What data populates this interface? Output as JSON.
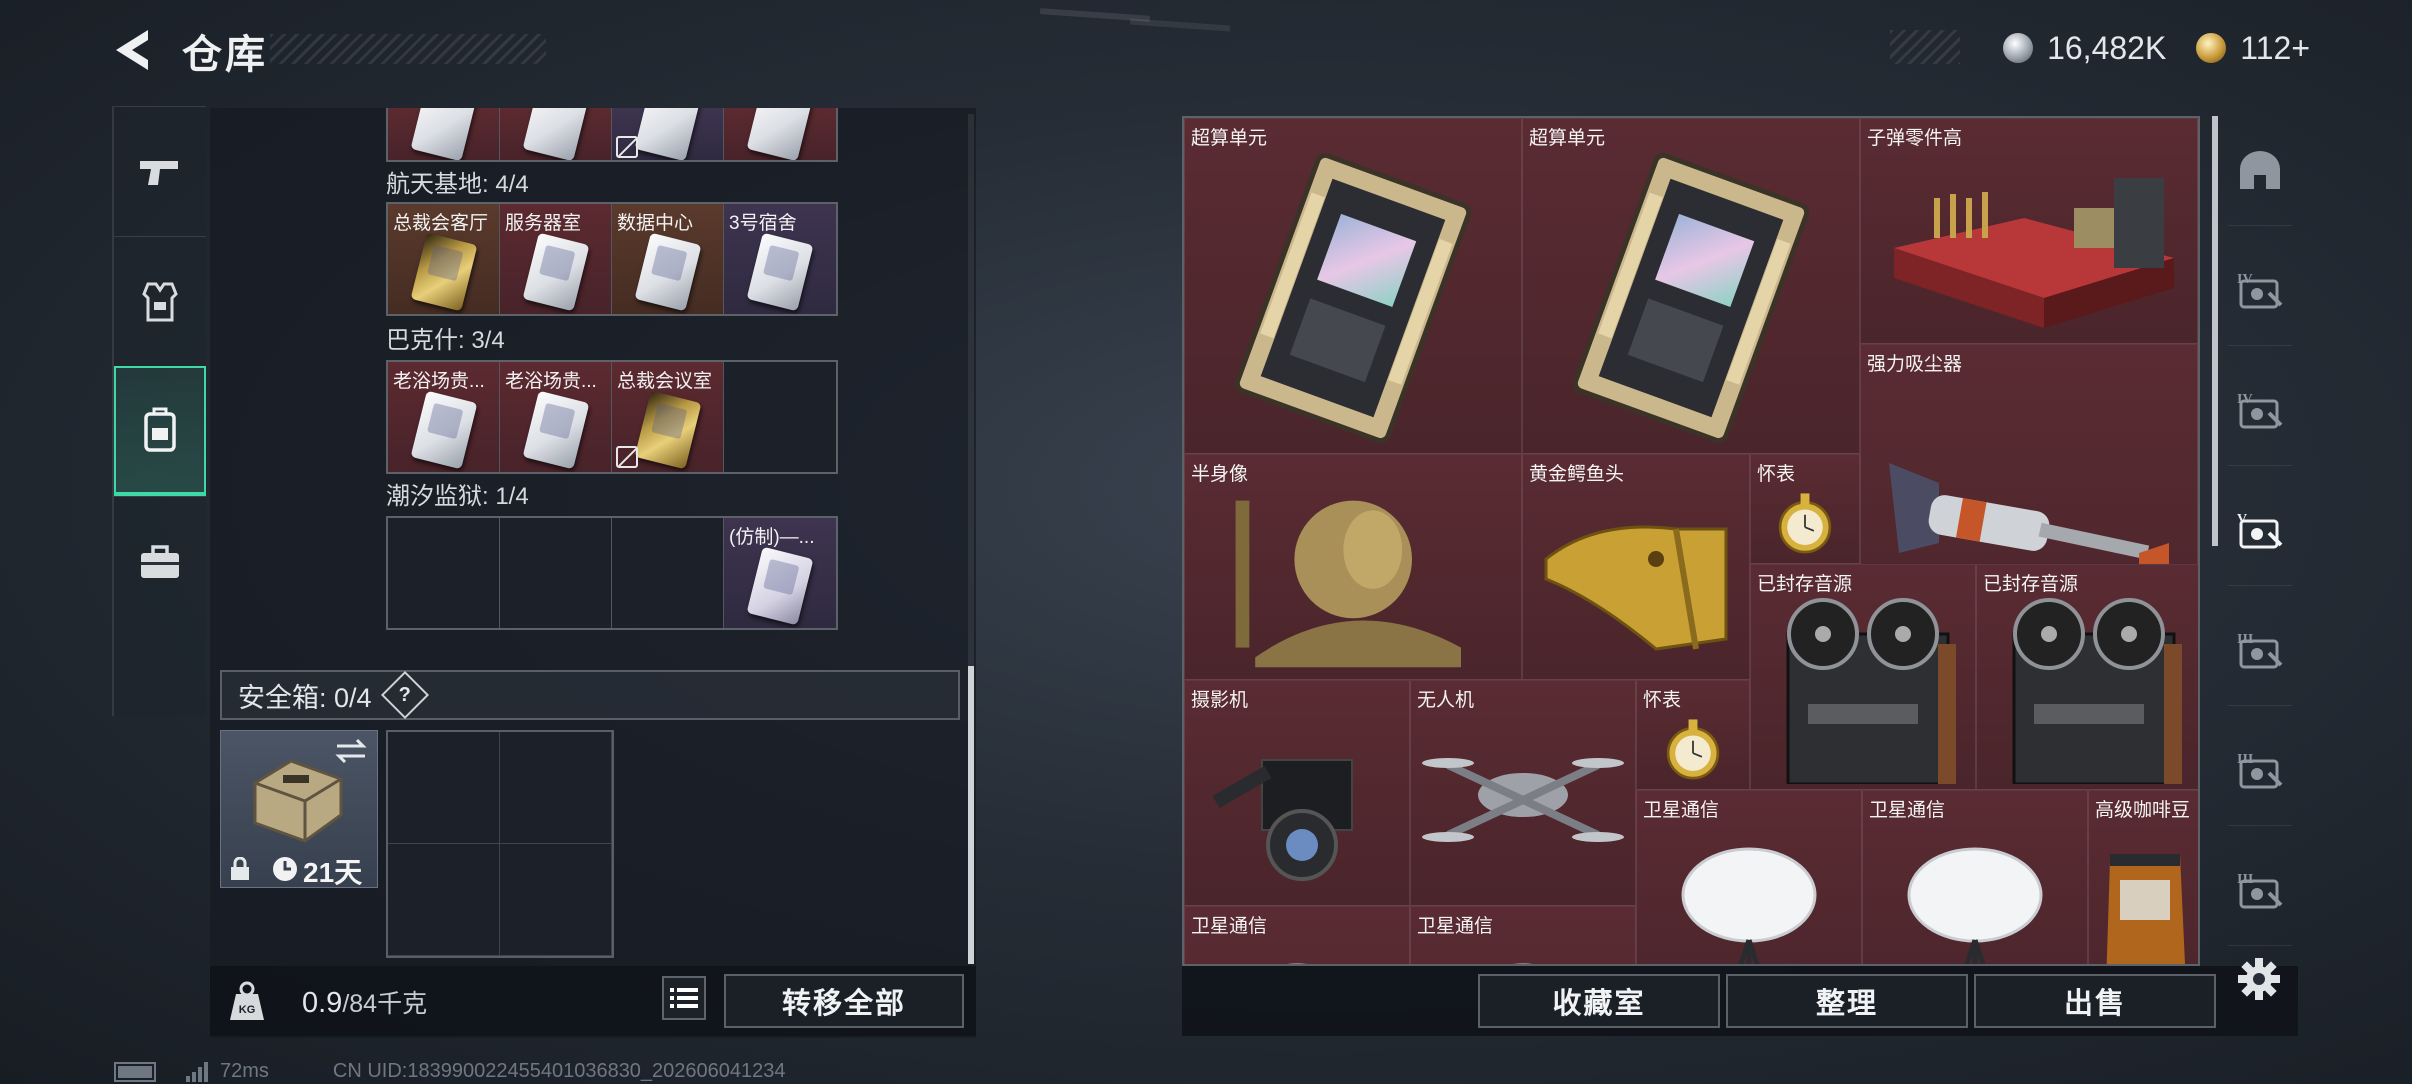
{
  "header": {
    "title": "仓库",
    "currency": {
      "silver": "16,482K",
      "gold": "112+"
    }
  },
  "left_nav": [
    {
      "icon": "pistol-icon",
      "active": false
    },
    {
      "icon": "armor-icon",
      "active": false
    },
    {
      "icon": "backpack-icon",
      "active": true
    },
    {
      "icon": "briefcase-icon",
      "active": false
    }
  ],
  "keycard_groups": [
    {
      "title": "航天基地: 4/4",
      "cards": [
        {
          "label": "总裁会客厅",
          "style": "brown",
          "card": "gold",
          "no_trade": false
        },
        {
          "label": "服务器室",
          "style": "red",
          "card": "white",
          "no_trade": false
        },
        {
          "label": "数据中心",
          "style": "brown",
          "card": "white",
          "no_trade": false
        },
        {
          "label": "3号宿舍",
          "style": "purple",
          "card": "white",
          "no_trade": false
        }
      ]
    },
    {
      "title": "巴克什: 3/4",
      "cards": [
        {
          "label": "老浴场贵...",
          "style": "red",
          "card": "white",
          "no_trade": false
        },
        {
          "label": "老浴场贵...",
          "style": "red",
          "card": "white",
          "no_trade": false
        },
        {
          "label": "总裁会议室",
          "style": "red",
          "card": "gold",
          "no_trade": true
        },
        {
          "label": "",
          "style": "empty",
          "card": "",
          "no_trade": false
        }
      ]
    },
    {
      "title": "潮汐监狱: 1/4",
      "cards": [
        {
          "label": "",
          "style": "empty",
          "card": "",
          "no_trade": false
        },
        {
          "label": "",
          "style": "empty",
          "card": "",
          "no_trade": false
        },
        {
          "label": "",
          "style": "empty",
          "card": "",
          "no_trade": false
        },
        {
          "label": "(仿制)—...",
          "style": "purple",
          "card": "lav",
          "no_trade": false
        }
      ]
    }
  ],
  "safe_box": {
    "label": "安全箱: 0/4",
    "help": "?",
    "days": "21天"
  },
  "bottom_left": {
    "weight_value": "0.9",
    "weight_unit": "/84千克",
    "weight_icon_text": "KG",
    "transfer_all": "转移全部"
  },
  "stash_items": [
    {
      "label": "超算单元",
      "icon": "supercomputer-unit-icon"
    },
    {
      "label": "超算单元",
      "icon": "supercomputer-unit-icon"
    },
    {
      "label": "子弹零件高",
      "icon": "ammo-parts-case-icon"
    },
    {
      "label": "强力吸尘器",
      "icon": "vacuum-cleaner-icon"
    },
    {
      "label": "半身像",
      "icon": "bust-statue-icon"
    },
    {
      "label": "黄金鳄鱼头",
      "icon": "golden-crocodile-head-icon"
    },
    {
      "label": "怀表",
      "icon": "pocket-watch-icon"
    },
    {
      "label": "已封存音源",
      "icon": "reel-recorder-icon"
    },
    {
      "label": "已封存音源",
      "icon": "reel-recorder-icon"
    },
    {
      "label": "摄影机",
      "icon": "video-camera-icon"
    },
    {
      "label": "无人机",
      "icon": "drone-icon"
    },
    {
      "label": "怀表",
      "icon": "pocket-watch-icon"
    },
    {
      "label": "卫星通信",
      "icon": "satellite-dish-icon"
    },
    {
      "label": "卫星通信",
      "icon": "satellite-dish-icon"
    },
    {
      "label": "高级咖啡豆",
      "icon": "coffee-beans-icon"
    },
    {
      "label": "卫星通信",
      "icon": "satellite-dish-icon"
    },
    {
      "label": "卫星通信",
      "icon": "satellite-dish-icon"
    }
  ],
  "bottom_right": {
    "collection": "收藏室",
    "sort": "整理",
    "sell": "出售"
  },
  "right_filters": [
    {
      "icon": "helmet-filter-icon",
      "tier": ""
    },
    {
      "icon": "card-tier-iv-filter-icon",
      "tier": "IV"
    },
    {
      "icon": "card-tier-iv-filter-icon",
      "tier": "IV"
    },
    {
      "icon": "card-tier-v-filter-icon",
      "tier": "V"
    },
    {
      "icon": "case-tier-iii-filter-icon",
      "tier": "III"
    },
    {
      "icon": "case-tier-iii-filter-icon",
      "tier": "III"
    },
    {
      "icon": "case-tier-iii-filter-icon",
      "tier": "III"
    }
  ],
  "footer": {
    "ping": "72ms",
    "uid": "CN UID:18399002245540103683​0_202606041234"
  }
}
